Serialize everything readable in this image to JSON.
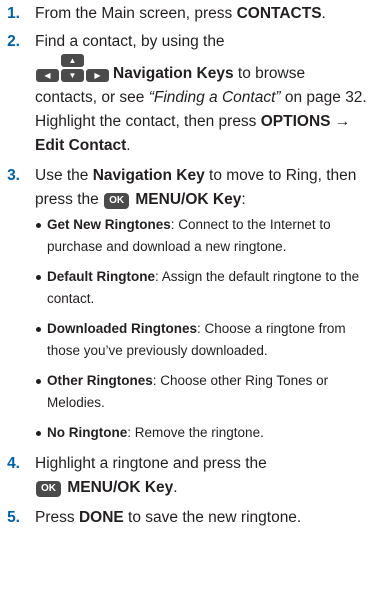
{
  "steps": [
    {
      "num": "1.",
      "t1": "From the Main screen, press ",
      "b1": "CONTACTS",
      "t2": "."
    },
    {
      "num": "2.",
      "t1": "Find a contact, by using the",
      "b1": "Navigation Keys",
      "t2": " to browse contacts, or see ",
      "i1": "“Finding a Contact”",
      "t3": " on page 32. Highlight the contact, then press ",
      "b2": "OPTIONS → Edit Contact",
      "t4": "."
    },
    {
      "num": "3.",
      "t1": "Use the ",
      "b1": "Navigation Key",
      "t2": " to move to Ring, then press the ",
      "key": "OK",
      "b2": "MENU/OK Key",
      "t3": ":",
      "options": [
        {
          "name": "Get New Ringtones",
          "desc": ": Connect to the Internet to purchase and download a new ringtone."
        },
        {
          "name": "Default Ringtone",
          "desc": ": Assign the default ringtone to the contact."
        },
        {
          "name": "Downloaded Ringtones",
          "desc": ": Choose a ringtone from those you’ve previously downloaded."
        },
        {
          "name": "Other Ringtones",
          "desc": ": Choose other Ring Tones or Melodies."
        },
        {
          "name": "No Ringtone",
          "desc": ": Remove the ringtone."
        }
      ]
    },
    {
      "num": "4.",
      "t1": "Highlight a ringtone and press the",
      "key": "OK",
      "b1": "MENU/OK Key",
      "t2": "."
    },
    {
      "num": "5.",
      "t1": "Press ",
      "b1": "DONE",
      "t2": " to save the new ringtone."
    }
  ],
  "icons": {
    "nav_up": "▲",
    "nav_left": "◀",
    "nav_down": "▼",
    "nav_right": "▶"
  },
  "colors": {
    "step_number": "#0060a8",
    "text": "#231f20",
    "key_background": "#4b4b4b"
  }
}
